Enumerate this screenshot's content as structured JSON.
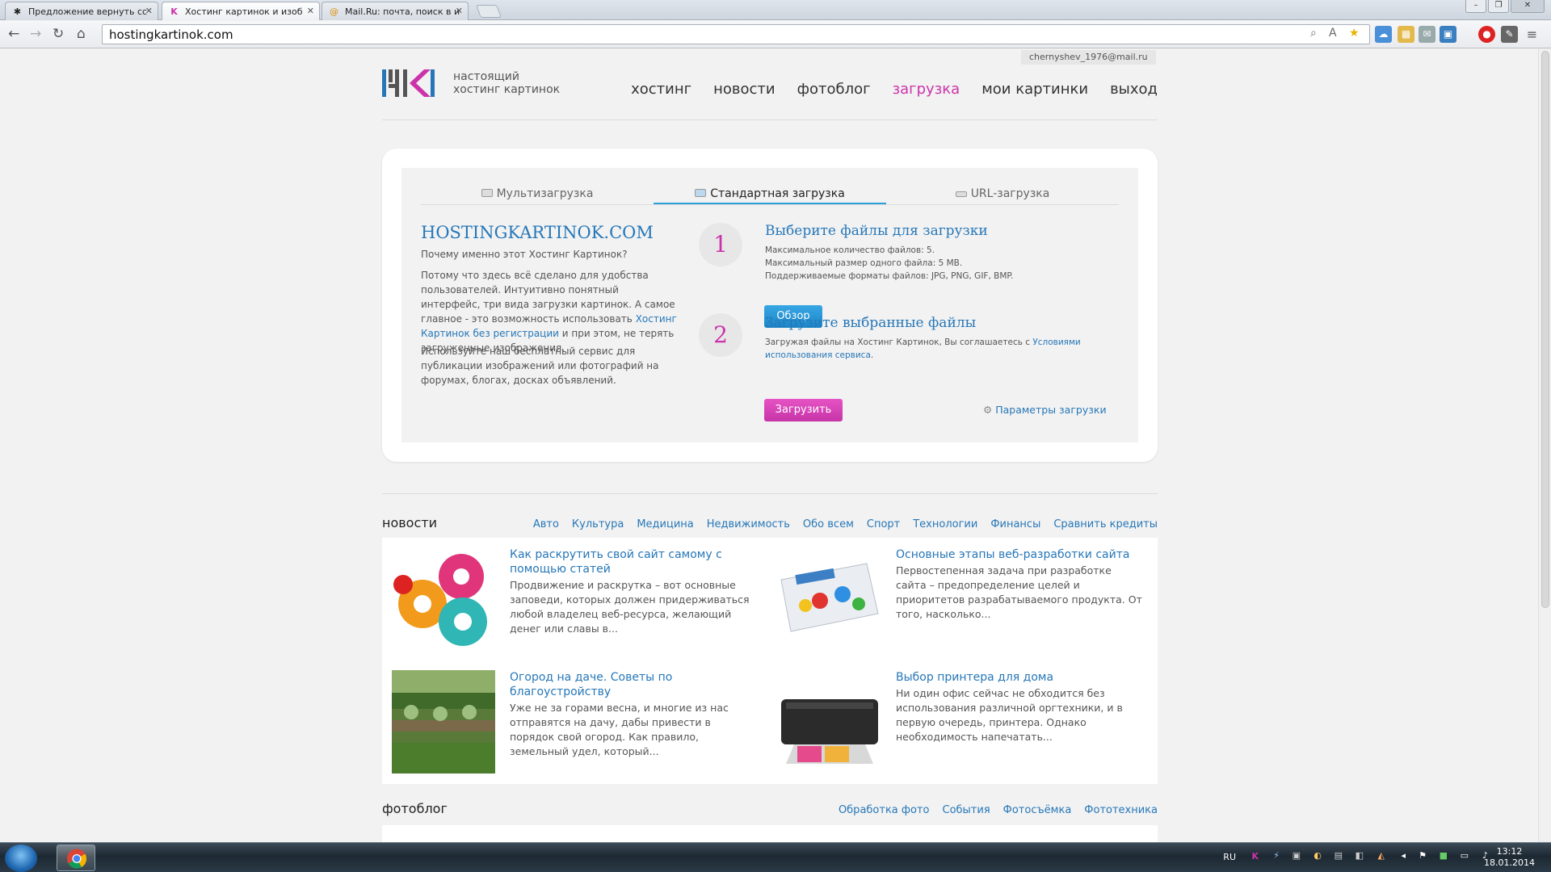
{
  "browser": {
    "tabs": [
      {
        "title": "Предложение вернуть сс",
        "active": false
      },
      {
        "title": "Хостинг картинок и изоб",
        "active": true
      },
      {
        "title": "Mail.Ru: почта, поиск в и",
        "active": false
      }
    ],
    "url": "hostingkartinok.com"
  },
  "site": {
    "user_email": "chernyshev_1976@mail.ru",
    "logo_line1": "настоящий",
    "logo_line2": "хостинг картинок",
    "nav": [
      "хостинг",
      "новости",
      "фотоблог",
      "загрузка",
      "мои картинки",
      "выход"
    ],
    "nav_active": "загрузка"
  },
  "upload": {
    "tabs": [
      "Мультизагрузка",
      "Стандартная загрузка",
      "URL-загрузка"
    ],
    "active_tab": "Стандартная загрузка",
    "heading": "HOSTINGKARTINOK.COM",
    "why": "Почему именно этот Хостинг Картинок?",
    "p1_before": "Потому что здесь всё сделано для удобства пользователей. Интуитивно понятный интерфейс, три вида загрузки картинок. А самое главное - это возможность использовать ",
    "p1_link": "Хостинг Картинок без регистрации",
    "p1_after": " и при этом, не терять загруженные изображения.",
    "p2": "Используйте наш бесплатный сервис для публикации изображений или фотографий на форумах, блогах, досках объявлений.",
    "step1_num": "1",
    "step1_title": "Выберите файлы для загрузки",
    "step1_line1": "Максимальное количество файлов: 5.",
    "step1_line2": "Максимальный размер одного файла: 5 MB.",
    "step1_line3": "Поддерживаемые форматы файлов: JPG, PNG, GIF, BMP.",
    "browse_btn": "Обзор",
    "step2_num": "2",
    "step2_title": "Загрузите выбранные файлы",
    "step2_before": "Загружая файлы на Хостинг Картинок, Вы соглашаетесь с ",
    "step2_link": "Условиями использования сервиса",
    "step2_after": ".",
    "upload_btn": "Загрузить",
    "params_link": "Параметры загрузки"
  },
  "news": {
    "title": "новости",
    "categories": [
      "Авто",
      "Культура",
      "Медицина",
      "Недвижимость",
      "Обо всем",
      "Спорт",
      "Технологии",
      "Финансы",
      "Сравнить кредиты"
    ],
    "items": [
      {
        "title": "Как раскрутить свой сайт самому с помощью статей",
        "text": "Продвижение и раскрутка – вот основные заповеди, которых должен придерживаться любой владелец веб-ресурса, желающий денег или славы в...",
        "image": "gears-image"
      },
      {
        "title": "Основные этапы веб-разработки сайта",
        "text": "Первостепенная задача при разработке сайта – предопределение целей и приоритетов разрабатываемого продукта. От того, насколько...",
        "image": "website-keyboard-image"
      },
      {
        "title": "Огород на даче. Советы по благоустройству",
        "text": "Уже не за горами весна, и многие из нас отправятся на дачу, дабы привести в порядок свой огород. Как правило, земельный удел, который...",
        "image": "garden-image"
      },
      {
        "title": "Выбор принтера для дома",
        "text": "Ни один офис сейчас не обходится без использования различной оргтехники, и в первую очередь, принтера. Однако необходимость напечатать...",
        "image": "printer-image"
      }
    ]
  },
  "photoblog": {
    "title": "фотоблог",
    "categories": [
      "Обработка фото",
      "События",
      "Фотосъёмка",
      "Фототехника"
    ]
  },
  "taskbar": {
    "lang": "RU",
    "time": "13:12",
    "date": "18.01.2014"
  },
  "colors": {
    "accent_blue": "#2677b8",
    "accent_pink": "#cc33aa",
    "button_blue": "#1c86c8"
  }
}
